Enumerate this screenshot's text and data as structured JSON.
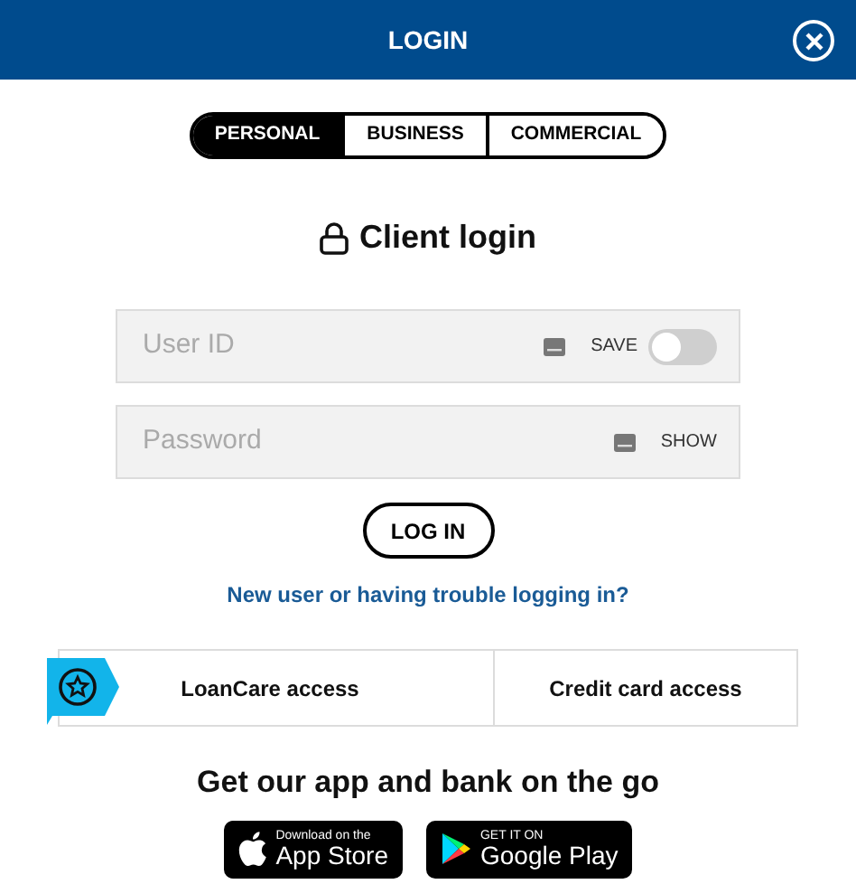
{
  "header": {
    "title": "LOGIN"
  },
  "tabs": [
    {
      "label": "PERSONAL",
      "selected": true
    },
    {
      "label": "BUSINESS",
      "selected": false
    },
    {
      "label": "COMMERCIAL",
      "selected": false
    }
  ],
  "heading": "Client login",
  "fields": [
    {
      "placeholder": "User ID",
      "action": "SAVE",
      "kind": "toggle",
      "on": false
    },
    {
      "placeholder": "Password",
      "action": "SHOW",
      "kind": "link"
    }
  ],
  "login_button": "LOG IN",
  "help_link": "New user or having trouble logging in?",
  "access": [
    {
      "label": "LoanCare access",
      "badge": true
    },
    {
      "label": "Credit card access",
      "badge": false
    }
  ],
  "app_heading": "Get our app and bank on the go",
  "stores": [
    {
      "kind": "apple",
      "small": "Download on the",
      "big": "App Store"
    },
    {
      "kind": "google",
      "small": "GET IT ON",
      "big": "Google Play"
    }
  ]
}
